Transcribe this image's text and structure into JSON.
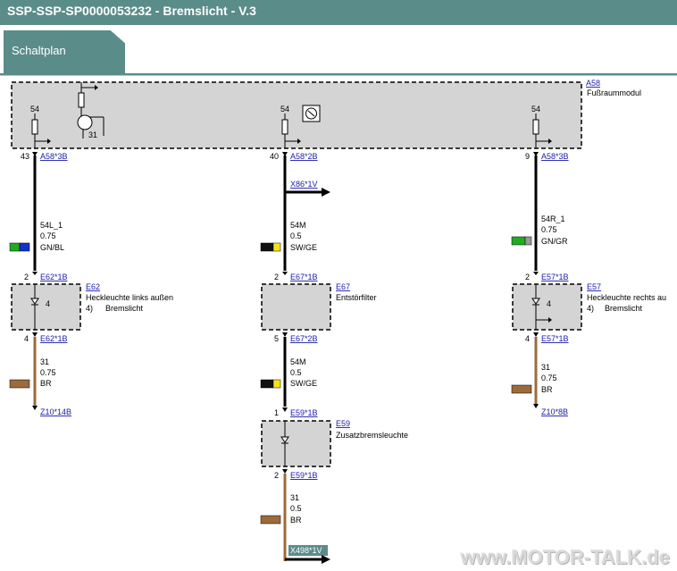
{
  "header": {
    "title": "SSP-SSP-SP0000053232  -  Bremslicht  -  V.3"
  },
  "tab": {
    "label": "Schaltplan"
  },
  "module": {
    "id_partial": "A58",
    "name": "Fußraummodul"
  },
  "columns": {
    "left": {
      "top_label": "54",
      "pin_top_num": "43",
      "pin_top": "A58*3B",
      "wire1": {
        "name": "54L_1",
        "size": "0.75",
        "color": "GN/BL",
        "c1": "#22aa22",
        "c2": "#1133cc"
      },
      "pin_comp_in_num": "2",
      "pin_comp_in": "E62*1B",
      "comp": {
        "id": "E62",
        "name": "Heckleuchte links außen",
        "note_num": "4)",
        "note": "Bremslicht",
        "pin": "4"
      },
      "pin_comp_out_num": "4",
      "pin_comp_out": "E62*1B",
      "wire2": {
        "name": "31",
        "size": "0.75",
        "color": "BR",
        "c1": "#9b6b3a"
      },
      "ground": "Z10*14B"
    },
    "middle": {
      "top_label": "54",
      "pin_top_num": "40",
      "pin_top": "A58*2B",
      "branch": "X86*1V",
      "wire1": {
        "name": "54M",
        "size": "0.5",
        "color": "SW/GE",
        "c1": "#111111",
        "c2": "#f2e21a"
      },
      "pin_comp_in_num": "2",
      "pin_comp_in": "E67*1B",
      "comp": {
        "id": "E67",
        "name": "Entstörfilter"
      },
      "pin_comp_out_num": "5",
      "pin_comp_out": "E67*2B",
      "wire2": {
        "name": "54M",
        "size": "0.5",
        "color": "SW/GE",
        "c1": "#111111",
        "c2": "#f2e21a"
      },
      "pin_comp2_in_num": "1",
      "pin_comp2_in": "E59*1B",
      "comp2": {
        "id": "E59",
        "name": "Zusatzbremsleuchte"
      },
      "pin_comp2_out_num": "2",
      "pin_comp2_out": "E59*1B",
      "wire3": {
        "name": "31",
        "size": "0.5",
        "color": "BR",
        "c1": "#9b6b3a"
      },
      "end": "X498*1V"
    },
    "right": {
      "top_label": "54",
      "pin_top_num": "9",
      "pin_top": "A58*3B",
      "wire1": {
        "name": "54R_1",
        "size": "0.75",
        "color": "GN/GR",
        "c1": "#22aa22",
        "c2": "#999999"
      },
      "pin_comp_in_num": "2",
      "pin_comp_in": "E57*1B",
      "comp": {
        "id": "E57",
        "name": "Heckleuchte rechts au",
        "note_num": "4)",
        "note": "Bremslicht",
        "pin": "4"
      },
      "pin_comp_out_num": "4",
      "pin_comp_out": "E57*1B",
      "wire2": {
        "name": "31",
        "size": "0.75",
        "color": "BR",
        "c1": "#9b6b3a"
      },
      "ground": "Z10*8B"
    },
    "transistor_pin": "31"
  },
  "watermark": "www.MOTOR-TALK.de"
}
